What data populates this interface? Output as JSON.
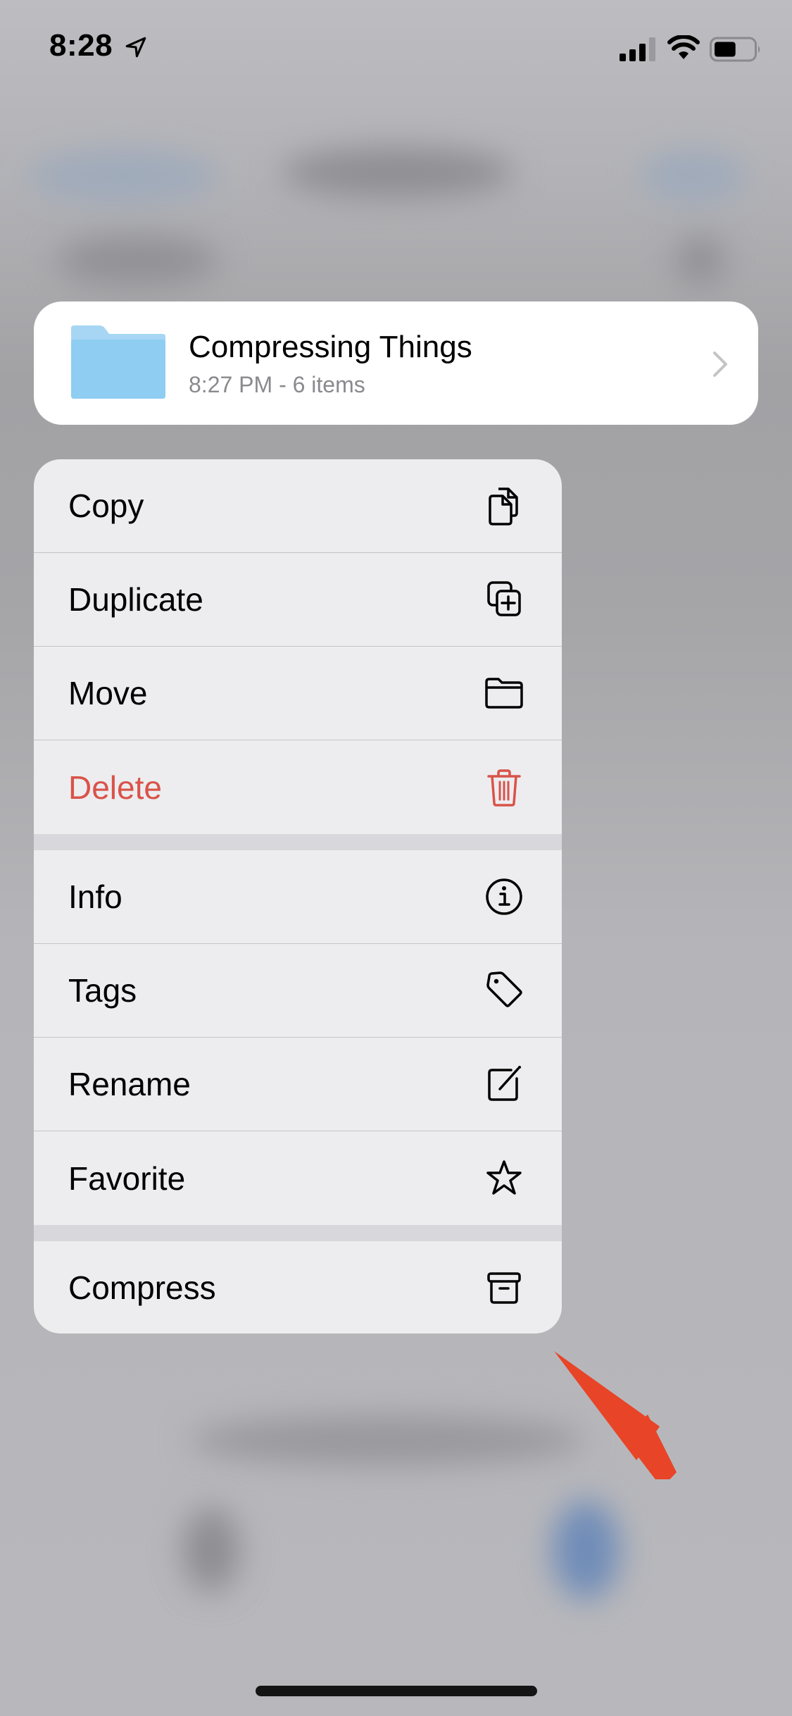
{
  "status_bar": {
    "time": "8:28",
    "location_icon": "location-arrow-icon",
    "signal_bars": 3,
    "signal_bars_total": 4,
    "wifi_icon": "wifi-icon",
    "battery_level": 0.55
  },
  "folder_preview": {
    "icon": "folder-icon",
    "name": "Compressing Things",
    "meta": "8:27 PM - 6 items",
    "chevron_icon": "chevron-right-icon"
  },
  "context_menu": {
    "groups": [
      [
        {
          "label": "Copy",
          "icon": "copy-icon"
        },
        {
          "label": "Duplicate",
          "icon": "duplicate-icon"
        },
        {
          "label": "Move",
          "icon": "folder-outline-icon"
        },
        {
          "label": "Delete",
          "icon": "trash-icon",
          "destructive": true
        }
      ],
      [
        {
          "label": "Info",
          "icon": "info-icon"
        },
        {
          "label": "Tags",
          "icon": "tag-icon"
        },
        {
          "label": "Rename",
          "icon": "edit-icon"
        },
        {
          "label": "Favorite",
          "icon": "star-icon"
        }
      ],
      [
        {
          "label": "Compress",
          "icon": "archive-box-icon"
        }
      ]
    ]
  },
  "annotation": {
    "arrow_color": "#e84427",
    "points_to": "Compress"
  },
  "colors": {
    "destructive": "#d9534a",
    "folder_blue": "#8fcdf2",
    "menu_bg": "#ededef"
  }
}
